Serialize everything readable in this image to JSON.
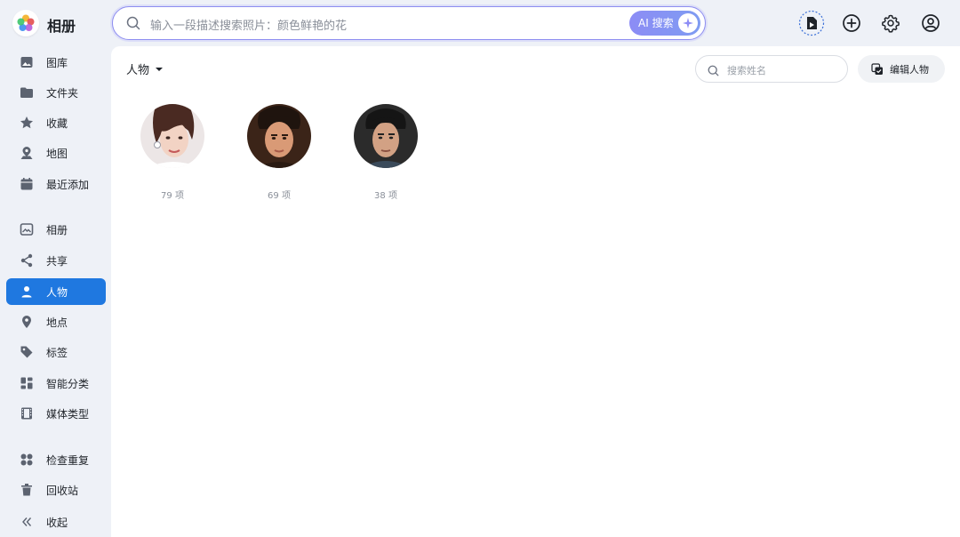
{
  "app": {
    "title": "相册"
  },
  "search": {
    "placeholder": "输入一段描述搜索照片：颜色鲜艳的花",
    "ai_label": "AI 搜索"
  },
  "sidebar": {
    "items": [
      {
        "label": "图库",
        "icon": "image-icon"
      },
      {
        "label": "文件夹",
        "icon": "folder-icon"
      },
      {
        "label": "收藏",
        "icon": "star-icon"
      },
      {
        "label": "地图",
        "icon": "map-pin-icon"
      },
      {
        "label": "最近添加",
        "icon": "calendar-icon"
      },
      {
        "label": "相册",
        "icon": "album-icon"
      },
      {
        "label": "共享",
        "icon": "share-icon"
      },
      {
        "label": "人物",
        "icon": "person-icon",
        "active": true
      },
      {
        "label": "地点",
        "icon": "location-icon"
      },
      {
        "label": "标签",
        "icon": "tag-icon"
      },
      {
        "label": "智能分类",
        "icon": "grid-icon"
      },
      {
        "label": "媒体类型",
        "icon": "film-icon"
      },
      {
        "label": "检查重复",
        "icon": "duplicate-icon"
      },
      {
        "label": "回收站",
        "icon": "trash-icon"
      }
    ],
    "collapse_label": "收起"
  },
  "main": {
    "view_label": "人物",
    "name_search_placeholder": "搜索姓名",
    "edit_label": "编辑人物",
    "people": [
      {
        "count": "79 项"
      },
      {
        "count": "69 项"
      },
      {
        "count": "38 项"
      }
    ]
  },
  "colors": {
    "accent": "#1f78e0",
    "ai_gradient": "#8c8cf5"
  }
}
